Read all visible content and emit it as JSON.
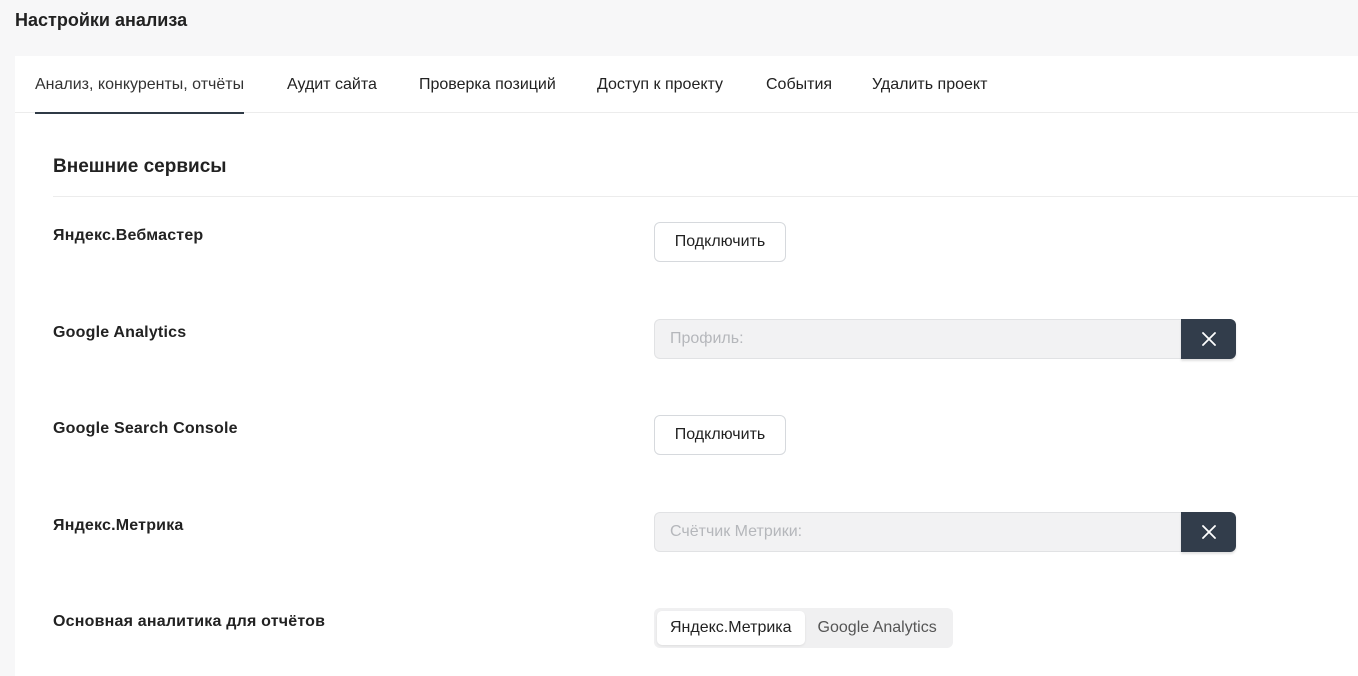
{
  "page": {
    "title": "Настройки анализа"
  },
  "tabs": [
    {
      "label": "Анализ, конкуренты, отчёты",
      "active": true
    },
    {
      "label": "Аудит сайта",
      "active": false
    },
    {
      "label": "Проверка позиций",
      "active": false
    },
    {
      "label": "Доступ к проекту",
      "active": false
    },
    {
      "label": "События",
      "active": false
    },
    {
      "label": "Удалить проект",
      "active": false
    }
  ],
  "section": {
    "title": "Внешние сервисы"
  },
  "services": {
    "yandex_webmaster": {
      "label": "Яндекс.Вебмастер",
      "button": "Подключить"
    },
    "google_analytics": {
      "label": "Google Analytics",
      "placeholder": "Профиль:",
      "value": ""
    },
    "google_search_console": {
      "label": "Google Search Console",
      "button": "Подключить"
    },
    "yandex_metrika": {
      "label": "Яндекс.Метрика",
      "placeholder": "Счётчик Метрики:",
      "value": ""
    }
  },
  "primary_analytics": {
    "label": "Основная аналитика для отчётов",
    "options": [
      "Яндекс.Метрика",
      "Google Analytics"
    ],
    "selected": "Яндекс.Метрика"
  },
  "colors": {
    "accent_dark": "#323d4b",
    "background": "#f7f7f8"
  },
  "icons": {
    "clear": "close-icon"
  }
}
